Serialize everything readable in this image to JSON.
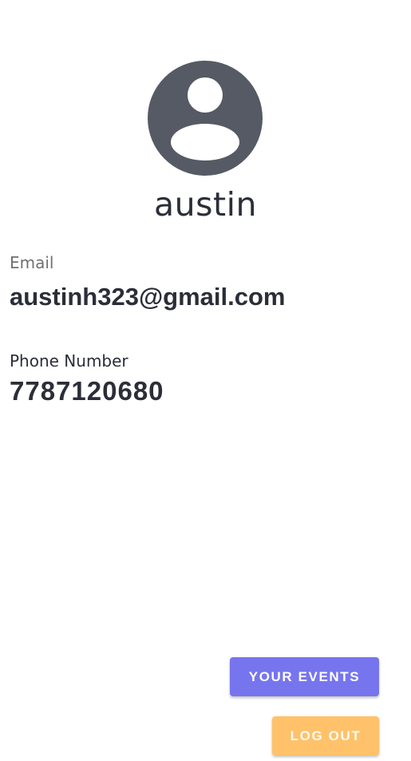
{
  "profile": {
    "username": "austin",
    "avatar_icon": "account-circle-icon",
    "avatar_color": "#555a64"
  },
  "fields": {
    "email_label": "Email",
    "email_value": "austinh323@gmail.com",
    "phone_label": "Phone Number",
    "phone_value": "7787120680"
  },
  "actions": {
    "your_events_label": "YOUR EVENTS",
    "your_events_color": "#7775ee",
    "log_out_label": "LOG OUT",
    "log_out_color": "#ffc26b"
  }
}
